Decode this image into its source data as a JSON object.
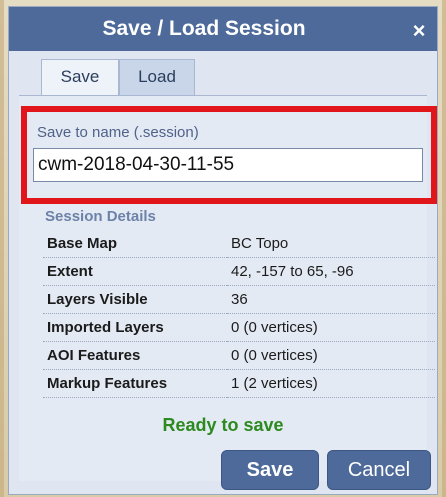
{
  "dialog": {
    "title": "Save / Load Session",
    "close_label": "×"
  },
  "tabs": [
    {
      "label": "Save",
      "selected": true
    },
    {
      "label": "Load",
      "selected": false
    }
  ],
  "save_panel": {
    "name_label": "Save to name (.session)",
    "name_value": "cwm-2018-04-30-11-55",
    "details_heading": "Session Details",
    "details": [
      {
        "key": "Base Map",
        "value": "BC Topo"
      },
      {
        "key": "Extent",
        "value": "42, -157 to 65, -96"
      },
      {
        "key": "Layers Visible",
        "value": "36"
      },
      {
        "key": "Imported Layers",
        "value": "0 (0 vertices)"
      },
      {
        "key": "AOI Features",
        "value": "0 (0 vertices)"
      },
      {
        "key": "Markup Features",
        "value": "1 (2 vertices)"
      }
    ],
    "status": "Ready to save"
  },
  "buttons": {
    "save_label": "Save",
    "cancel_label": "Cancel"
  },
  "colors": {
    "titlebar": "#4d6a9a",
    "highlight": "#e0161a",
    "status_text": "#2c8a1f"
  }
}
